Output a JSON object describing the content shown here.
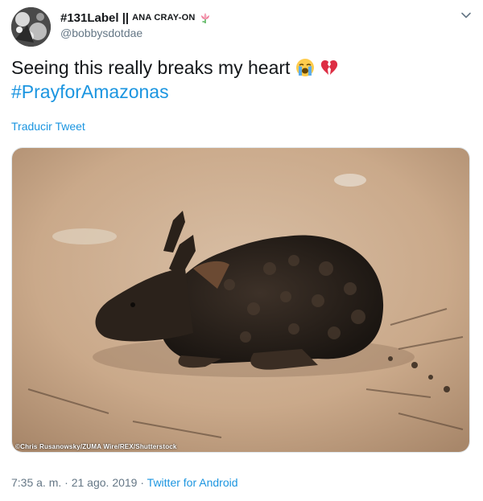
{
  "user": {
    "display_name": "#131Label ||",
    "display_name_small": "ANA CRAY-ON",
    "handle": "@bobbysdotdae",
    "name_emoji_icon": "lotus-flower-icon"
  },
  "tweet": {
    "text_line1": "Seeing this really breaks my heart",
    "emojis": [
      "loudly-crying-face-icon",
      "broken-heart-icon"
    ],
    "hashtag": "#PrayforAmazonas",
    "translate_label": "Traducir Tweet",
    "image_credit": "©Chris Rusanowsky/ZUMA Wire/REX/Shutterstock",
    "time": "7:35 a. m.",
    "separator": "·",
    "date": "21 ago. 2019",
    "source": "Twitter for Android"
  },
  "colors": {
    "link": "#1b95e0",
    "secondary_text": "#657786",
    "primary_text": "#14171a"
  }
}
